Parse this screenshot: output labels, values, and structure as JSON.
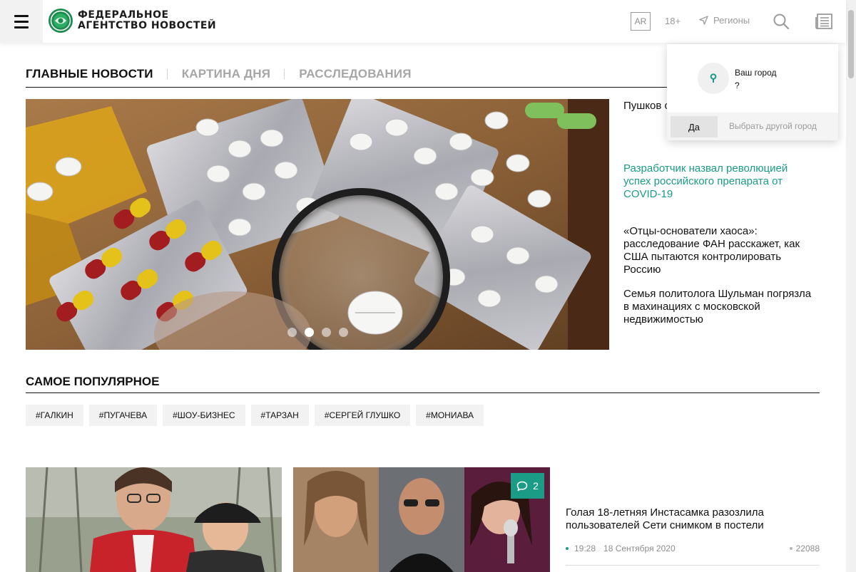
{
  "header": {
    "logo_line1": "ФЕДЕРАЛЬНОЕ",
    "logo_line2": "АГЕНТСТВО НОВОСТЕЙ",
    "ar_label": "AR",
    "age_label": "18+",
    "regions_label": "Регионы"
  },
  "tabs": [
    {
      "label": "ГЛАВНЫЕ НОВОСТИ",
      "active": true
    },
    {
      "label": "КАРТИНА ДНЯ",
      "active": false
    },
    {
      "label": "РАССЛЕДОВАНИЯ",
      "active": false
    }
  ],
  "slider": {
    "count": 4,
    "active_index": 1
  },
  "news": [
    "Пушков о прокомментировал Украины",
    "Разработчик назвал революцией успех российского препарата от COVID-19",
    "«Отцы-основатели хаоса»: расследование ФАН расскажет, как США пытаются контролировать Россию",
    "Семья политолога Шульман погрязла в махинациях с московской недвижимостью"
  ],
  "city_popup": {
    "question_line1": "Ваш город",
    "question_line2": "?",
    "yes_label": "Да",
    "other_label": "Выбрать другой город"
  },
  "popular": {
    "title": "САМОЕ ПОПУЛЯРНОЕ",
    "tags": [
      "#ГАЛКИН",
      "#ПУГАЧЕВА",
      "#ШОУ-БИЗНЕС",
      "#ТАРЗАН",
      "#СЕРГЕЙ ГЛУШКО",
      "#МОНИАВА"
    ]
  },
  "cards": {
    "comments_count": "2",
    "article_title": "Голая 18-летняя Инстасамка разозлила пользователей Сети снимком в постели",
    "article_time": "19:28",
    "article_date": "18 Сентября 2020",
    "article_views": "22088"
  },
  "colors": {
    "accent": "#1a9c86",
    "text": "#111111",
    "muted": "#a6a6a6"
  }
}
